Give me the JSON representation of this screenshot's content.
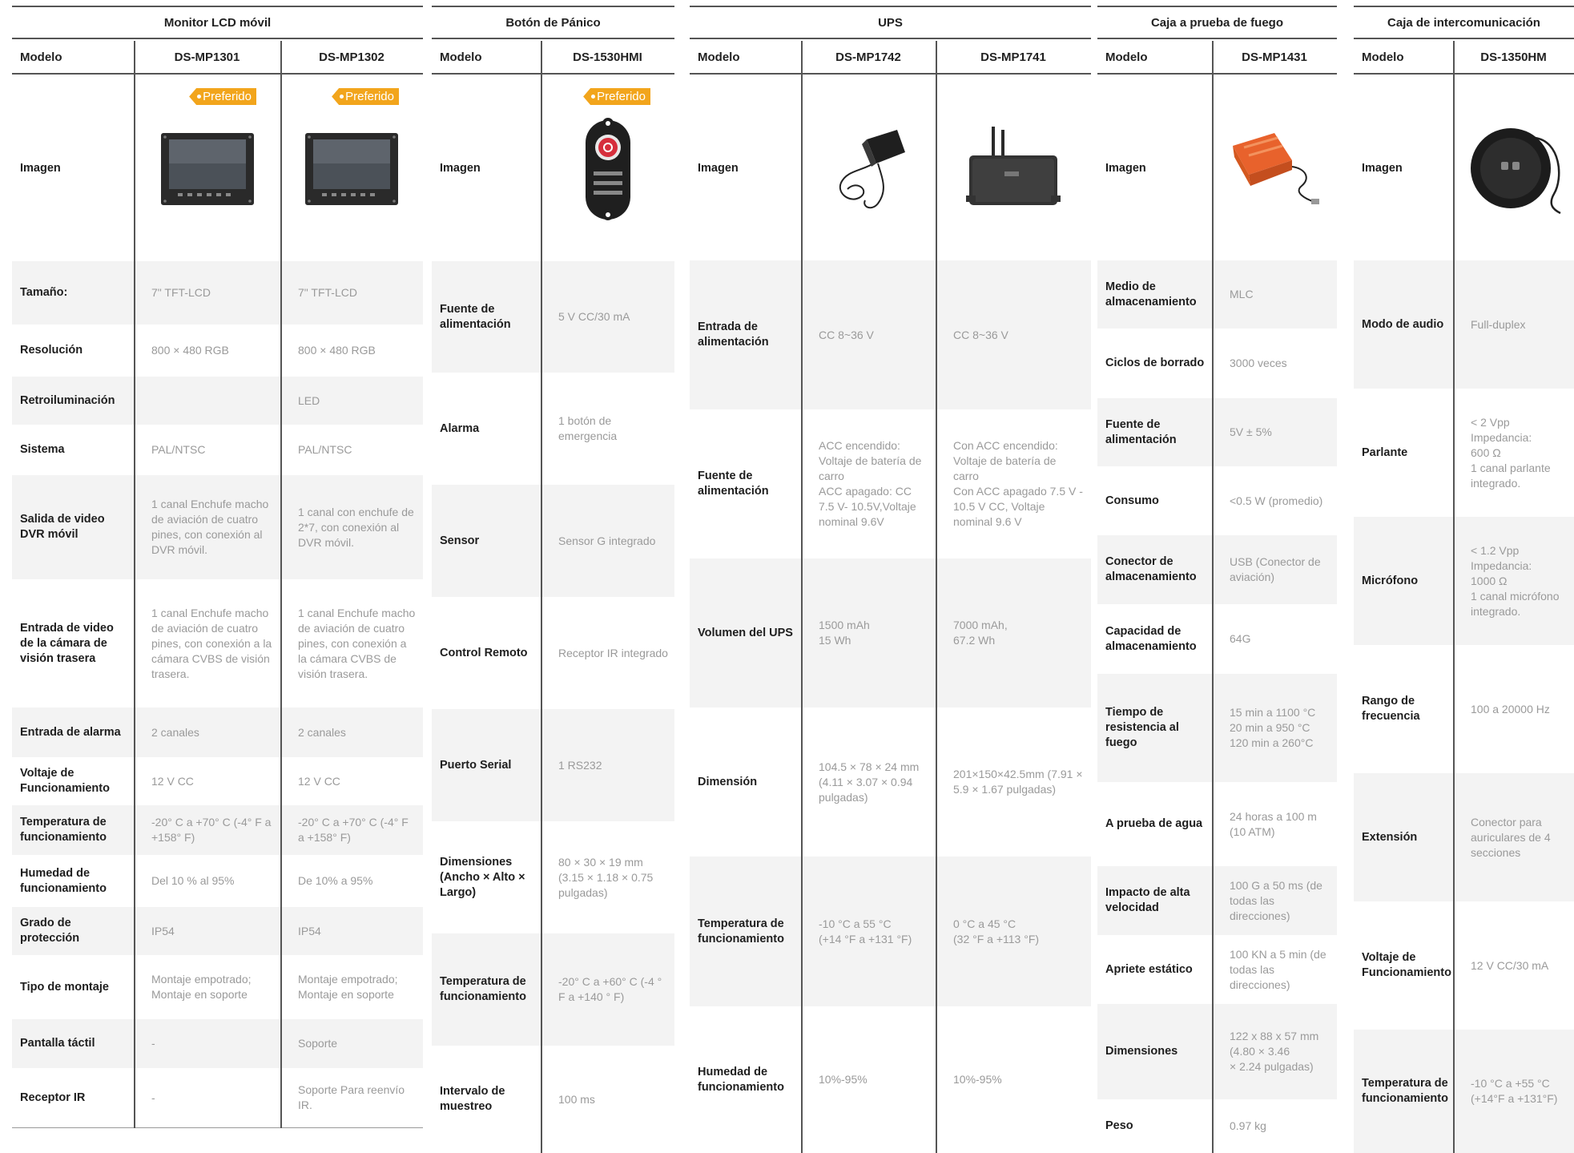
{
  "common": {
    "model_label": "Modelo",
    "image_label": "Imagen",
    "preferred_badge": "Preferido"
  },
  "monitor": {
    "title": "Monitor LCD móvil",
    "models": [
      "DS-MP1301",
      "DS-MP1302"
    ],
    "rows": [
      {
        "label": "Tamaño:",
        "values": [
          "7\" TFT-LCD",
          "7\" TFT-LCD"
        ]
      },
      {
        "label": "Resolución",
        "values": [
          "800 × 480 RGB",
          "800 × 480 RGB"
        ]
      },
      {
        "label": "Retroiluminación",
        "values": [
          "",
          "LED"
        ]
      },
      {
        "label": "Sistema",
        "values": [
          "PAL/NTSC",
          "PAL/NTSC"
        ]
      },
      {
        "label": "Salida de video DVR móvil",
        "values": [
          "1 canal Enchufe macho de aviación de cuatro pines, con conexión al DVR móvil.",
          "1 canal con enchufe de 2*7, con conexión al DVR móvil."
        ]
      },
      {
        "label": "Entrada de video de la cámara de visión trasera",
        "values": [
          "1 canal Enchufe macho de aviación de cuatro pines, con conexión a la cámara CVBS de visión trasera.",
          "1 canal Enchufe macho de aviación de cuatro pines, con conexión a la cámara CVBS de visión trasera."
        ]
      },
      {
        "label": "Entrada de alarma",
        "values": [
          "2 canales",
          "2 canales"
        ]
      },
      {
        "label": "Voltaje de Funcionamiento",
        "values": [
          "12 V CC",
          "12 V CC"
        ]
      },
      {
        "label": "Temperatura de funcionamiento",
        "values": [
          "-20° C a +70° C (-4° F a +158° F)",
          "-20° C a +70° C (-4° F a +158° F)"
        ]
      },
      {
        "label": "Humedad de funcionamiento",
        "values": [
          "Del 10 % al 95%",
          "De 10% a 95%"
        ]
      },
      {
        "label": "Grado de protección",
        "values": [
          "IP54",
          "IP54"
        ]
      },
      {
        "label": "Tipo de montaje",
        "values": [
          "Montaje empotrado; Montaje en soporte",
          "Montaje empotrado; Montaje en soporte"
        ]
      },
      {
        "label": "Pantalla táctil",
        "values": [
          "-",
          "Soporte"
        ]
      },
      {
        "label": "Receptor IR",
        "values": [
          "-",
          "Soporte Para reenvío IR."
        ]
      }
    ]
  },
  "panic": {
    "title": "Botón de Pánico",
    "models": [
      "DS-1530HMI"
    ],
    "rows": [
      {
        "label": "Fuente de alimentación",
        "values": [
          "5 V CC/30 mA"
        ]
      },
      {
        "label": "Alarma",
        "values": [
          "1 botón de emergencia"
        ]
      },
      {
        "label": "Sensor",
        "values": [
          "Sensor G integrado"
        ]
      },
      {
        "label": "Control Remoto",
        "values": [
          "Receptor IR integrado"
        ]
      },
      {
        "label": "Puerto Serial",
        "values": [
          "1 RS232"
        ]
      },
      {
        "label": "Dimensiones (Ancho × Alto × Largo)",
        "values": [
          "80 × 30 × 19 mm (3.15 × 1.18 × 0.75 pulgadas)"
        ]
      },
      {
        "label": "Temperatura de funcionamiento",
        "values": [
          "-20° C a +60° C (-4 ° F a +140 ° F)"
        ]
      },
      {
        "label": "Intervalo de muestreo",
        "values": [
          "100 ms"
        ]
      }
    ]
  },
  "ups": {
    "title": "UPS",
    "models": [
      "DS-MP1742",
      "DS-MP1741"
    ],
    "rows": [
      {
        "label": "Entrada de alimentación",
        "values": [
          "CC 8~36 V",
          "CC 8~36 V"
        ]
      },
      {
        "label": "Fuente de alimentación",
        "values": [
          "ACC encendido: Voltaje de batería de carro\nACC apagado: CC 7.5 V- 10.5V,Voltaje nominal 9.6V",
          "Con ACC encendido: Voltaje de batería de carro\nCon ACC apagado 7.5 V - 10.5 V CC, Voltaje nominal 9.6 V"
        ]
      },
      {
        "label": "Volumen del UPS",
        "values": [
          "1500 mAh\n15 Wh",
          "7000 mAh,\n67.2 Wh"
        ]
      },
      {
        "label": "Dimensión",
        "values": [
          "104.5 × 78 × 24 mm (4.11 × 3.07 × 0.94 pulgadas)",
          "201×150×42.5mm (7.91 × 5.9 × 1.67 pulgadas)"
        ]
      },
      {
        "label": "Temperatura de funcionamiento",
        "values": [
          "-10 °C a 55 °C\n(+14 °F a +131 °F)",
          "0 °C a 45 °C\n(32 °F a +113 °F)"
        ]
      },
      {
        "label": "Humedad de funcionamiento",
        "values": [
          "10%-95%",
          "10%-95%"
        ]
      }
    ]
  },
  "firebox": {
    "title": "Caja a prueba de fuego",
    "models": [
      "DS-MP1431"
    ],
    "rows": [
      {
        "label": "Medio de almacenamiento",
        "values": [
          "MLC"
        ]
      },
      {
        "label": "Ciclos de borrado",
        "values": [
          "3000 veces"
        ]
      },
      {
        "label": "Fuente de alimentación",
        "values": [
          "5V ± 5%"
        ]
      },
      {
        "label": "Consumo",
        "values": [
          "<0.5 W (promedio)"
        ]
      },
      {
        "label": "Conector de almacenamiento",
        "values": [
          "USB (Conector de aviación)"
        ]
      },
      {
        "label": "Capacidad de almacenamiento",
        "values": [
          "64G"
        ]
      },
      {
        "label": "Tiempo de resistencia al fuego",
        "values": [
          "15 min a 1100 °C\n20 min a 950 °C\n120 min a 260°C"
        ]
      },
      {
        "label": "A prueba de agua",
        "values": [
          "24 horas a 100 m (10 ATM)"
        ]
      },
      {
        "label": "Impacto de alta velocidad",
        "values": [
          "100 G a 50 ms (de todas las direcciones)"
        ]
      },
      {
        "label": "Apriete estático",
        "values": [
          "100 KN a 5 min (de todas las direcciones)"
        ]
      },
      {
        "label": "Dimensiones",
        "values": [
          "122 x 88 x 57 mm (4.80 × 3.46\n× 2.24 pulgadas)"
        ]
      },
      {
        "label": "Peso",
        "values": [
          "0.97 kg"
        ]
      }
    ]
  },
  "intercom": {
    "title": "Caja de intercomunicación",
    "models": [
      "DS-1350HM"
    ],
    "rows": [
      {
        "label": "Modo de audio",
        "values": [
          "Full-duplex"
        ]
      },
      {
        "label": "Parlante",
        "values": [
          "< 2 Vpp\nImpedancia:\n600 Ω\n1 canal parlante integrado."
        ]
      },
      {
        "label": "Micrófono",
        "values": [
          "< 1.2 Vpp\nImpedancia:\n1000 Ω\n1 canal micrófono integrado."
        ]
      },
      {
        "label": "Rango de frecuencia",
        "values": [
          "100 a 20000 Hz"
        ]
      },
      {
        "label": "Extensión",
        "values": [
          "Conector para auriculares de 4 secciones"
        ]
      },
      {
        "label": "Voltaje de Funcionamiento",
        "values": [
          "12 V CC/30 mA"
        ]
      },
      {
        "label": "Temperatura de funcionamiento",
        "values": [
          "-10 °C a +55 °C\n(+14°F a +131°F)"
        ]
      }
    ]
  }
}
